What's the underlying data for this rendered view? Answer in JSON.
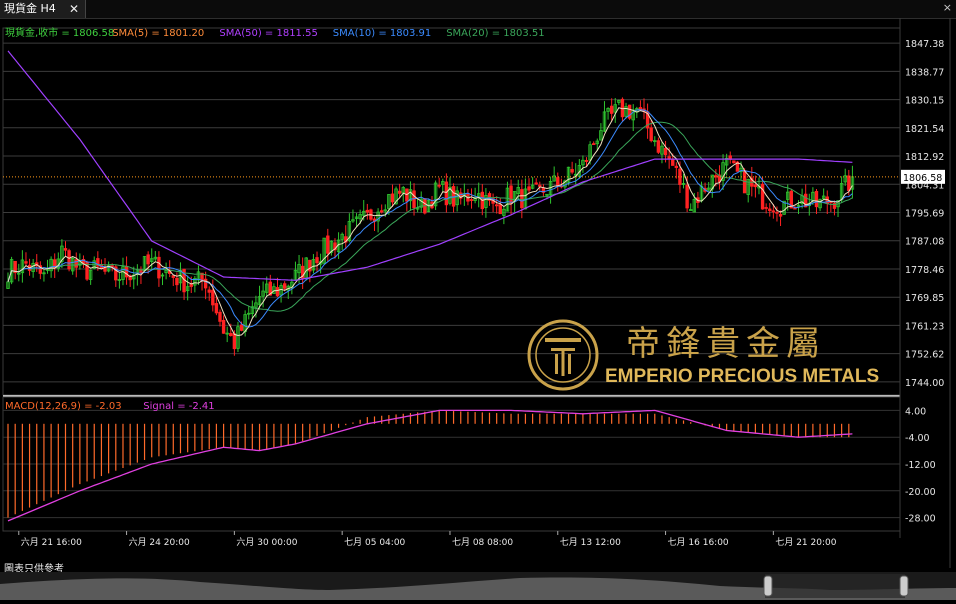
{
  "tab": {
    "title": "現貨金 H4",
    "close_glyph": "✕"
  },
  "window": {
    "close_glyph": "×"
  },
  "price_legend": [
    {
      "label": "現貨金,收市 = 1806.58",
      "color": "#3fd13f"
    },
    {
      "label": "SMA(5) = 1801.20",
      "color": "#ff8c3a"
    },
    {
      "label": "SMA(50) = 1811.55",
      "color": "#b040ff"
    },
    {
      "label": "SMA(10) = 1803.91",
      "color": "#3b8bff"
    },
    {
      "label": "SMA(20) = 1803.51",
      "color": "#3aa65a"
    }
  ],
  "macd_legend": [
    {
      "label": "MACD(12,26,9) = -2.03",
      "color": "#ff6a2a"
    },
    {
      "label": "Signal = -2.41",
      "color": "#e040e0"
    }
  ],
  "logo": {
    "chinese": "帝鋒貴金屬",
    "english": "EMPERIO PRECIOUS METALS"
  },
  "footer_note": "圖表只供參考",
  "chart_data": {
    "type": "candlestick",
    "title": "現貨金 H4",
    "price_axis": {
      "ylim": [
        1740,
        1852
      ],
      "ticks": [
        "1847.38",
        "1838.77",
        "1830.15",
        "1821.54",
        "1812.92",
        "1804.31",
        "1795.69",
        "1787.08",
        "1778.46",
        "1769.85",
        "1761.23",
        "1752.62",
        "1744.00"
      ],
      "current": "1806.58"
    },
    "macd_axis": {
      "ylim": [
        -32,
        8
      ],
      "ticks": [
        "4.00",
        "-4.00",
        "-12.00",
        "-20.00",
        "-28.00"
      ]
    },
    "x_ticks": [
      "六月 21 16:00",
      "六月 24 20:00",
      "六月 30 00:00",
      "七月 05 04:00",
      "七月 08 08:00",
      "七月 13 12:00",
      "七月 16 16:00",
      "七月 21 20:00"
    ],
    "x_tick_index": [
      3,
      33,
      63,
      93,
      123,
      153,
      183,
      213
    ],
    "close_anchors": [
      [
        0,
        1778
      ],
      [
        5,
        1780
      ],
      [
        10,
        1776
      ],
      [
        15,
        1784
      ],
      [
        20,
        1778
      ],
      [
        25,
        1778
      ],
      [
        30,
        1776
      ],
      [
        35,
        1778
      ],
      [
        40,
        1780
      ],
      [
        45,
        1777
      ],
      [
        50,
        1774
      ],
      [
        55,
        1775
      ],
      [
        60,
        1760
      ],
      [
        63,
        1756
      ],
      [
        67,
        1764
      ],
      [
        70,
        1770
      ],
      [
        75,
        1772
      ],
      [
        80,
        1776
      ],
      [
        85,
        1782
      ],
      [
        90,
        1786
      ],
      [
        95,
        1790
      ],
      [
        100,
        1794
      ],
      [
        105,
        1800
      ],
      [
        110,
        1802
      ],
      [
        115,
        1797
      ],
      [
        120,
        1803
      ],
      [
        125,
        1799
      ],
      [
        130,
        1802
      ],
      [
        135,
        1797
      ],
      [
        140,
        1801
      ],
      [
        145,
        1800
      ],
      [
        150,
        1803
      ],
      [
        155,
        1806
      ],
      [
        160,
        1810
      ],
      [
        165,
        1822
      ],
      [
        170,
        1827
      ],
      [
        175,
        1827
      ],
      [
        180,
        1818
      ],
      [
        185,
        1810
      ],
      [
        190,
        1798
      ],
      [
        195,
        1805
      ],
      [
        200,
        1810
      ],
      [
        205,
        1805
      ],
      [
        210,
        1800
      ],
      [
        215,
        1798
      ],
      [
        220,
        1800
      ],
      [
        225,
        1798
      ],
      [
        230,
        1800
      ],
      [
        235,
        1806
      ]
    ],
    "sma50_anchors": [
      [
        0,
        1845
      ],
      [
        20,
        1818
      ],
      [
        40,
        1787
      ],
      [
        60,
        1776
      ],
      [
        80,
        1775
      ],
      [
        100,
        1779
      ],
      [
        120,
        1786
      ],
      [
        140,
        1795
      ],
      [
        160,
        1805
      ],
      [
        180,
        1812
      ],
      [
        200,
        1812
      ],
      [
        220,
        1812
      ],
      [
        235,
        1811
      ]
    ],
    "macd_anchors": [
      [
        0,
        -28
      ],
      [
        20,
        -18
      ],
      [
        40,
        -10
      ],
      [
        60,
        -7
      ],
      [
        70,
        -8
      ],
      [
        80,
        -6
      ],
      [
        100,
        2
      ],
      [
        120,
        4
      ],
      [
        140,
        3
      ],
      [
        160,
        3
      ],
      [
        180,
        3
      ],
      [
        200,
        -2
      ],
      [
        220,
        -4
      ],
      [
        235,
        -4
      ]
    ],
    "signal_anchors": [
      [
        0,
        -29
      ],
      [
        20,
        -20
      ],
      [
        40,
        -12
      ],
      [
        60,
        -7
      ],
      [
        70,
        -8
      ],
      [
        80,
        -6
      ],
      [
        100,
        0
      ],
      [
        120,
        4
      ],
      [
        140,
        4
      ],
      [
        160,
        3
      ],
      [
        180,
        4
      ],
      [
        200,
        -2
      ],
      [
        220,
        -4
      ],
      [
        235,
        -3
      ]
    ],
    "series_count": 236,
    "last_close": 1806.58
  }
}
